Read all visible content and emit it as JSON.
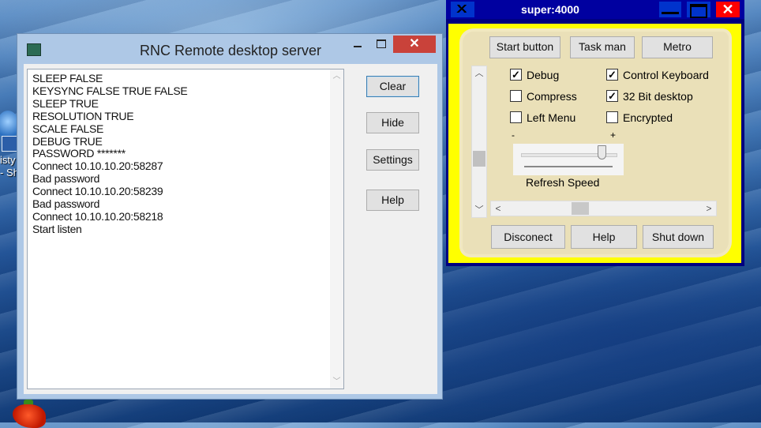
{
  "desktop": {
    "label_line1": "isty",
    "label_line2": "- Sh"
  },
  "rnc": {
    "title": "RNC Remote desktop server",
    "close_glyph": "✕",
    "log": [
      "SLEEP FALSE",
      "KEYSYNC FALSE TRUE FALSE",
      "SLEEP TRUE",
      "RESOLUTION TRUE",
      "SCALE FALSE",
      "DEBUG TRUE",
      "PASSWORD *******",
      "Connect 10.10.10.20:58287",
      "Bad password",
      "Connect 10.10.10.20:58239",
      "Bad password",
      "Connect 10.10.10.20:58218",
      "Start listen"
    ],
    "buttons": {
      "clear": "Clear",
      "hide": "Hide",
      "settings": "Settings",
      "help": "Help"
    }
  },
  "super": {
    "title": "super:4000",
    "close_glyph": "✕",
    "buttons": {
      "start": "Start button",
      "taskman": "Task man",
      "metro": "Metro",
      "disconnect": "Disconect",
      "help": "Help",
      "shutdown": "Shut down"
    },
    "options": {
      "debug": {
        "label": "Debug",
        "checked": true
      },
      "control_keyboard": {
        "label": "Control Keyboard",
        "checked": true
      },
      "compress": {
        "label": "Compress",
        "checked": false
      },
      "bit32": {
        "label": "32 Bit desktop",
        "checked": true
      },
      "left_menu": {
        "label": "Left Menu",
        "checked": false
      },
      "encrypted": {
        "label": "Encrypted",
        "checked": false
      }
    },
    "slider": {
      "minus": "-",
      "plus": "+",
      "label": "Refresh Speed",
      "value_fraction": 0.85
    },
    "colors": {
      "frame": "#ffff00",
      "titlebar": "#000080",
      "close": "#ff0000"
    }
  }
}
